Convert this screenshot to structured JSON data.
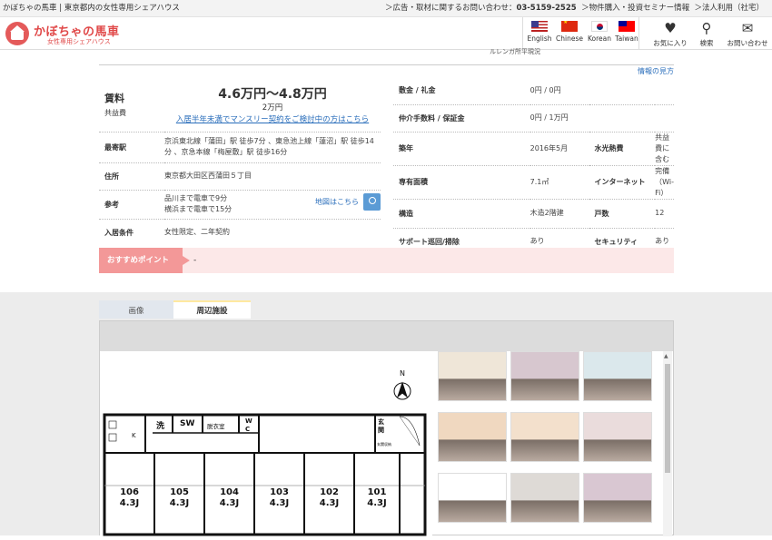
{
  "topbar": {
    "left": "かぼちゃの馬車 | 東京都内の女性専用シェアハウス",
    "ad_label": "＞広告・取材に関するお問い合わせ：",
    "phone": "03-5159-2525",
    "seminar": "＞物件購入・投資セミナー情報",
    "corporate": "＞法人利用（社宅）"
  },
  "header": {
    "logo_title": "かぼちゃの馬車",
    "logo_sub": "女性専用シェアハウス",
    "langs": [
      "English",
      "Chinese",
      "Korean",
      "Taiwan"
    ],
    "favorites": "お気に入り",
    "search": "検索",
    "contact": "お問い合わせ"
  },
  "cut_text": "ルレンガ所平現況",
  "info_link": "情報の見方",
  "left": {
    "rent_label": "賃料",
    "fee_label": "共益費",
    "rent": "4.6万円〜4.8万円",
    "fee": "2万円",
    "monthly_link": "入居半年未満でマンスリー契約をご検討中の方はこちら",
    "station_label": "最寄駅",
    "station": "京浜東北線「蒲田」駅 徒歩7分 、東急池上線「蓮沼」駅 徒歩14分 、京急本線「梅屋敷」駅 徒歩16分",
    "address_label": "住所",
    "address": "東京都大田区西蒲田５丁目",
    "ref_label": "参考",
    "ref_line1": "品川まで電車で9分",
    "ref_line2": "横浜まで電車で15分",
    "map_link": "地図はこちら",
    "cond_label": "入居条件",
    "cond": "女性限定、二年契約"
  },
  "right": {
    "deposit_label": "敷金 / 礼金",
    "deposit": "0円 / 0円",
    "agency_label": "仲介手数料 / 保証金",
    "agency": "0円 / 1万円",
    "built_label": "築年",
    "built": "2016年5月",
    "utilities_label": "水光熱費",
    "utilities": "共益費に含む",
    "area_label": "専有面積",
    "area": "7.1㎡",
    "internet_label": "インターネット",
    "internet": "完備（Wi-Fi）",
    "struct_label": "構造",
    "struct": "木造2階建",
    "units_label": "戸数",
    "units": "12",
    "support_label": "サポート巡回/掃除",
    "support": "あり",
    "security_label": "セキュリティ",
    "security": "あり"
  },
  "recommend": {
    "label": "おすすめポイント",
    "value": "-"
  },
  "tabs": [
    "画像",
    "周辺施設"
  ],
  "floorplan": {
    "north": "N",
    "rooms": [
      {
        "no": "106",
        "size": "4.3J"
      },
      {
        "no": "105",
        "size": "4.3J"
      },
      {
        "no": "104",
        "size": "4.3J"
      },
      {
        "no": "103",
        "size": "4.3J"
      },
      {
        "no": "102",
        "size": "4.3J"
      },
      {
        "no": "101",
        "size": "4.3J"
      }
    ],
    "k": "K",
    "wash": "洗",
    "sw": "SW",
    "dress": "脱衣室",
    "wc": "W C",
    "entrance": "玄 関",
    "shoebox": "玄関収納"
  },
  "thumb_colors": [
    "#efe6d8",
    "#d7c7cf",
    "#dbe8ec",
    "#f0d8c0",
    "#f3e0cc",
    "#eadcdc",
    "#ffffff",
    "#dedad6",
    "#d9c7d2"
  ]
}
